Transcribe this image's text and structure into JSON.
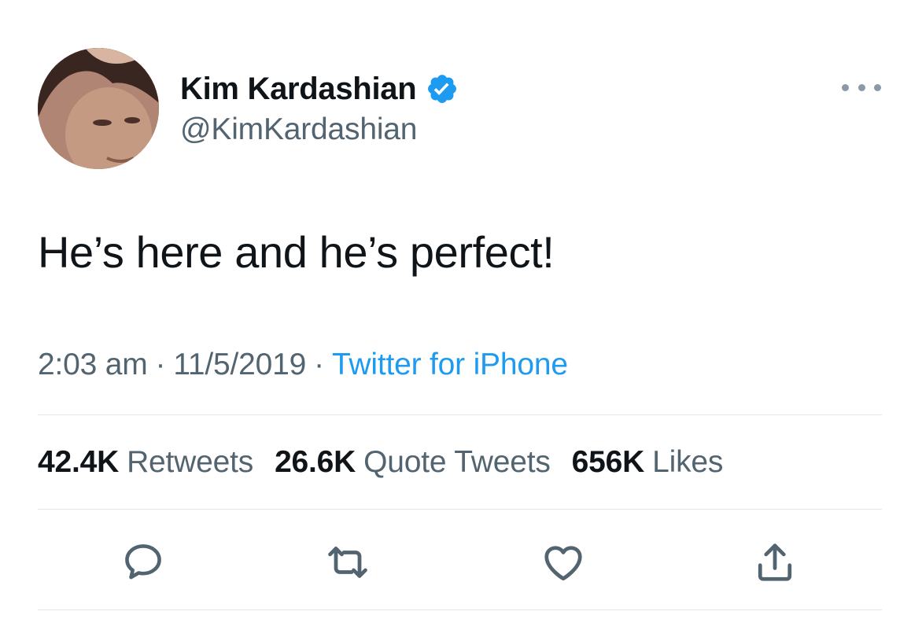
{
  "user": {
    "display_name": "Kim Kardashian",
    "handle": "@KimKardashian",
    "verified": true
  },
  "tweet": {
    "text": "He’s here and he’s perfect!",
    "time": "2:03 am",
    "date": "11/5/2019",
    "separator": "·",
    "source": "Twitter for iPhone"
  },
  "stats": [
    {
      "count": "42.4K",
      "label": "Retweets"
    },
    {
      "count": "26.6K",
      "label": "Quote Tweets"
    },
    {
      "count": "656K",
      "label": "Likes"
    }
  ],
  "icons": {
    "verified": "verified-badge-icon",
    "more": "more-options-icon",
    "reply": "reply-icon",
    "retweet": "retweet-icon",
    "like": "like-heart-icon",
    "share": "share-icon"
  },
  "colors": {
    "accent": "#1d9bf0",
    "text_primary": "#0f1419",
    "text_secondary": "#536471",
    "divider": "#e1e6ea"
  }
}
